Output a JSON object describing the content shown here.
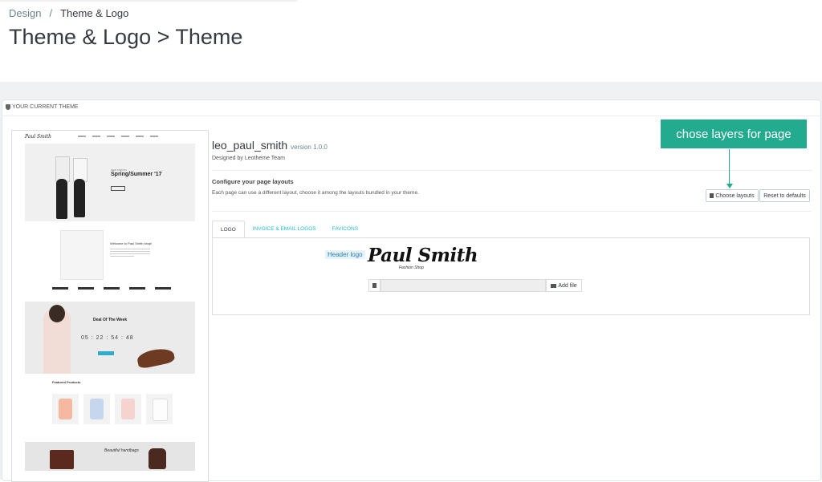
{
  "breadcrumb": {
    "parent": "Design",
    "separator": "/",
    "current": "Theme & Logo"
  },
  "page_title": "Theme & Logo > Theme",
  "panel": {
    "heading": "YOUR CURRENT THEME"
  },
  "preview": {
    "logo": "Paul Smith",
    "hero_small": "NEW ARRIVAL",
    "hero_title": "Spring/Summer '17",
    "welcome": "Welcome to Paul Smith shop!",
    "deal_title": "Deal Of The Week",
    "deal_countdown": "05 : 22 : 54 : 48",
    "featured": "Featured Products",
    "bags": "Beautiful handbags"
  },
  "theme": {
    "name": "leo_paul_smith",
    "version": "version 1.0.0",
    "designed_by": "Designed by Leotheme Team",
    "config_title": "Configure your page layouts",
    "config_desc": "Each page can use a different layout, choose it among the layouts bundled in your theme."
  },
  "buttons": {
    "choose_layouts": "Choose layouts",
    "reset_defaults": "Reset to defaults",
    "add_file": "Add file"
  },
  "callout": "chose layers for page",
  "tabs": [
    {
      "label": "LOGO",
      "active": true
    },
    {
      "label": "INVOICE & EMAIL LOGOS",
      "active": false
    },
    {
      "label": "FAVICONS",
      "active": false
    }
  ],
  "logo_section": {
    "label": "Header logo",
    "logo_text": "Paul Smith",
    "logo_sub": "Fashion Shop"
  }
}
